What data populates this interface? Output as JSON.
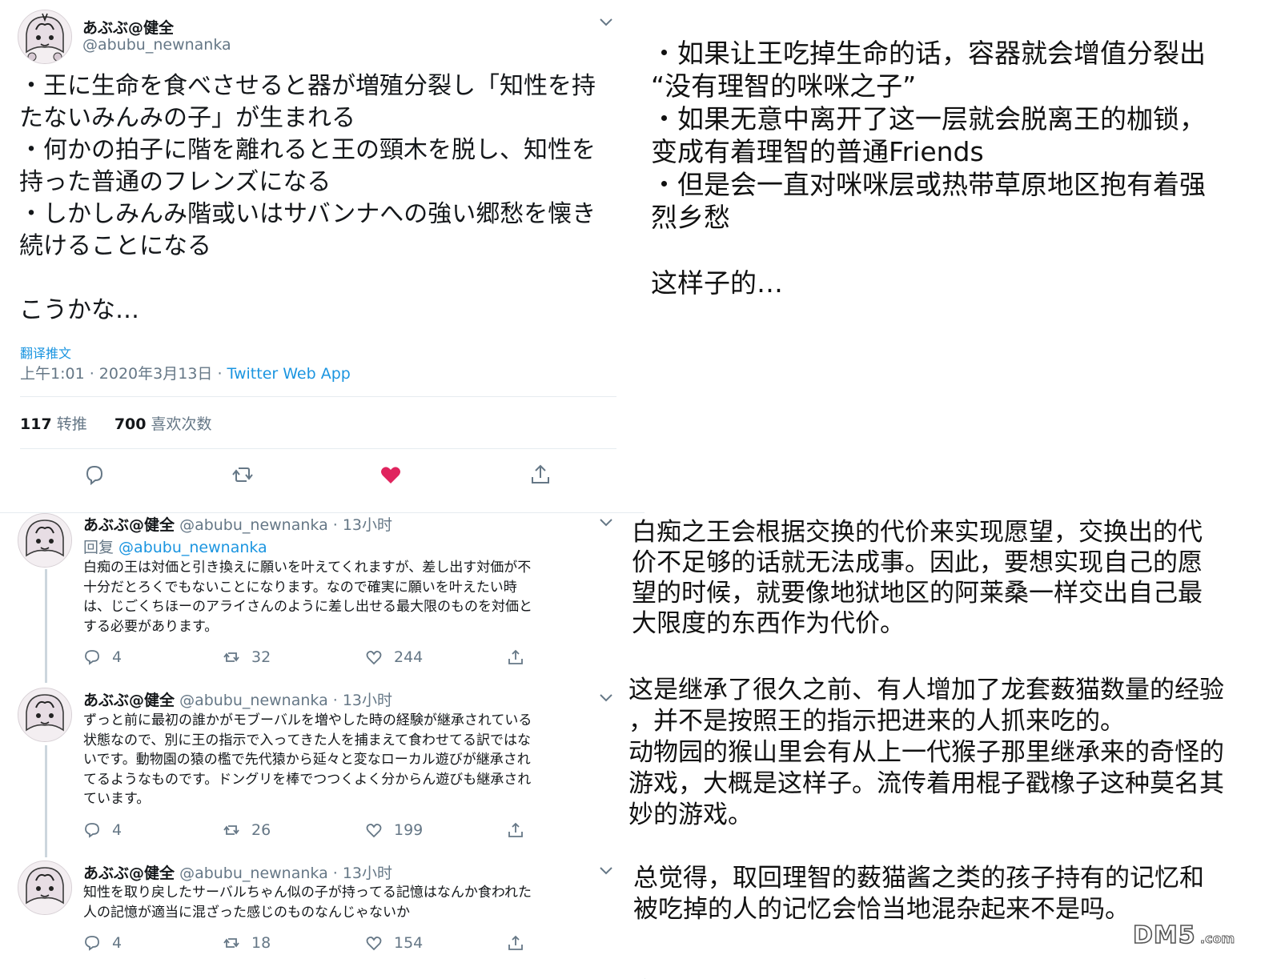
{
  "main_tweet": {
    "author_name": "あぶぶ@健全",
    "author_handle": "@abubu_newnanka",
    "lines": [
      "・王に生命を食べさせると器が増殖分裂し「知性を持",
      "たないみんみの子」が生まれる",
      "・何かの拍子に階を離れると王の頸木を脱し、知性を",
      "持った普通のフレンズになる",
      "・しかしみんみ階或いはサバンナへの強い郷愁を懐き",
      "続けることになる",
      "",
      "こうかな…"
    ],
    "translate_label": "翻译推文",
    "timestamp": "上午1:01 · 2020年3月13日 · ",
    "source_app": "Twitter Web App",
    "retweet_count": "117",
    "retweet_label": "转推",
    "like_count": "700",
    "like_label": "喜欢次数"
  },
  "replies": [
    {
      "author_name": "あぶぶ@健全",
      "author_handle": "@abubu_newnanka · 13小时",
      "reply_prefix": "回复 ",
      "reply_target": "@abubu_newnanka",
      "lines": [
        "白痴の王は対価と引き換えに願いを叶えてくれますが、差し出す対価が不",
        "十分だとろくでもないことになります。なので確実に願いを叶えたい時",
        "は、じごくちほーのアライさんのように差し出せる最大限のものを対価と",
        "する必要があります。"
      ],
      "reply_count": "4",
      "retweet_count": "32",
      "like_count": "244"
    },
    {
      "author_name": "あぶぶ@健全",
      "author_handle": "@abubu_newnanka · 13小时",
      "lines": [
        "ずっと前に最初の誰かがモブーバルを増やした時の経験が継承されている",
        "状態なので、別に王の指示で入ってきた人を捕まえて食わせてる訳ではな",
        "いです。動物園の猿の檻で先代猿から延々と変なローカル遊びが継承され",
        "てるようなものです。ドングリを棒でつつくよく分からん遊びも継承され",
        "ています。"
      ],
      "reply_count": "4",
      "retweet_count": "26",
      "like_count": "199"
    },
    {
      "author_name": "あぶぶ@健全",
      "author_handle": "@abubu_newnanka · 13小时",
      "lines": [
        "知性を取り戻したサーバルちゃん似の子が持ってる記憶はなんか食われた",
        "人の記憶が適当に混ざった感じのものなんじゃないか"
      ],
      "reply_count": "4",
      "retweet_count": "18",
      "like_count": "154"
    }
  ],
  "translations": {
    "main": [
      "・如果让王吃掉生命的话，容器就会增值分裂出",
      "“没有理智的咪咪之子”",
      "・如果无意中离开了这一层就会脱离王的枷锁，",
      "变成有着理智的普通Friends",
      "・但是会一直对咪咪层或热带草原地区抱有着强",
      "烈乡愁",
      "",
      "这样子的…"
    ],
    "reply1": [
      "白痴之王会根据交换的代价来实现愿望，交换出的代",
      "价不足够的话就无法成事。因此，要想实现自己的愿",
      "望的时候，就要像地狱地区的阿莱桑一样交出自己最",
      "大限度的东西作为代价。"
    ],
    "reply2": [
      "这是继承了很久之前、有人增加了龙套薮猫数量的经验",
      "，并不是按照王的指示把进来的人抓来吃的。",
      "动物园的猴山里会有从上一代猴子那里继承来的奇怪的",
      "游戏，大概是这样子。流传着用棍子戳橡子这种莫名其",
      "妙的游戏。"
    ],
    "reply3": [
      "总觉得，取回理智的薮猫酱之类的孩子持有的记忆和",
      "被吃掉的人的记忆会恰当地混杂起来不是吗。"
    ]
  },
  "watermark": "DM5.com",
  "colors": {
    "link": "#1b95e0",
    "muted": "#657786",
    "like_active": "#e0245e"
  }
}
